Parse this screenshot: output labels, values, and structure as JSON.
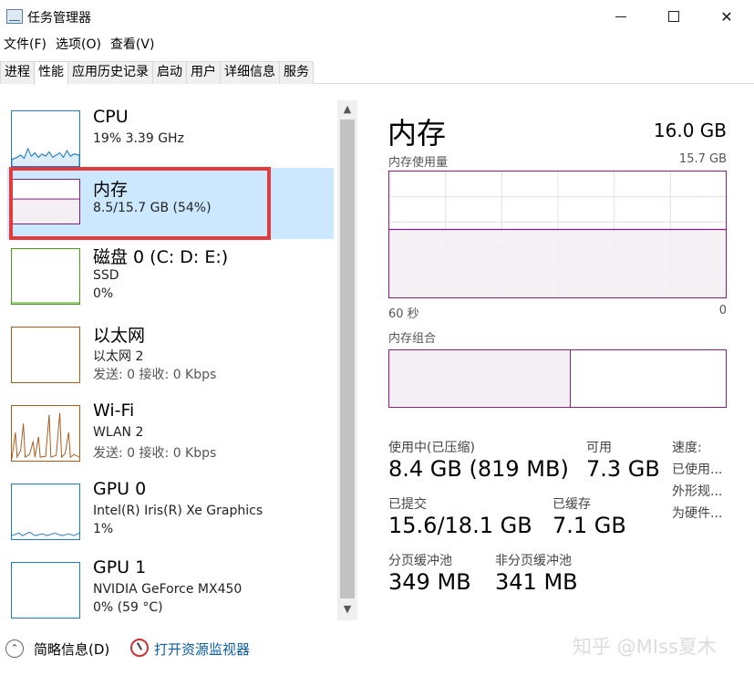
{
  "window": {
    "title": "任务管理器"
  },
  "menu": [
    "文件(F)",
    "选项(O)",
    "查看(V)"
  ],
  "tabs": [
    "进程",
    "性能",
    "应用历史记录",
    "启动",
    "用户",
    "详细信息",
    "服务"
  ],
  "active_tab": "性能",
  "resources": [
    {
      "name": "CPU",
      "line1": "19% 3.39 GHz",
      "line2": "",
      "color": "#1f7ac3"
    },
    {
      "name": "内存",
      "line1": "8.5/15.7 GB (54%)",
      "line2": "",
      "color": "#8b1a8b"
    },
    {
      "name": "磁盘 0 (C: D: E:)",
      "line1": "SSD",
      "line2": "0%",
      "color": "#4b9b1b"
    },
    {
      "name": "以太网",
      "line1": "以太网 2",
      "line2": "发送: 0 接收: 0 Kbps",
      "color": "#a85a1c"
    },
    {
      "name": "Wi-Fi",
      "line1": "WLAN 2",
      "line2": "发送: 0 接收: 0 Kbps",
      "color": "#a85a1c"
    },
    {
      "name": "GPU 0",
      "line1": "Intel(R) Iris(R) Xe Graphics",
      "line2": "1%",
      "color": "#1f7ac3"
    },
    {
      "name": "GPU 1",
      "line1": "NVIDIA GeForce MX450",
      "line2": "0% (59 °C)",
      "color": "#1f7ac3"
    }
  ],
  "memory": {
    "title": "内存",
    "total": "16.0 GB",
    "usage_graph_label": "内存使用量",
    "usage_graph_max": "15.7 GB",
    "usage_fraction": 0.54,
    "time_left": "60 秒",
    "time_right": "0",
    "composition_label": "内存组合",
    "composition_in_use_fraction": 0.54,
    "stats": {
      "in_use_label": "使用中(已压缩)",
      "in_use_value": "8.4 GB (819 MB)",
      "available_label": "可用",
      "available_value": "7.3 GB",
      "committed_label": "已提交",
      "committed_value": "15.6/18.1 GB",
      "cached_label": "已缓存",
      "cached_value": "7.1 GB",
      "paged_label": "分页缓冲池",
      "paged_value": "349 MB",
      "nonpaged_label": "非分页缓冲池",
      "nonpaged_value": "341 MB",
      "speed_label": "速度:",
      "used_label": "已使用...",
      "form_factor_label": "外形规...",
      "hw_reserved_label": "为硬件..."
    }
  },
  "footer": {
    "brief": "简略信息(D)",
    "monitor_link": "打开资源监视器",
    "watermark": "知乎 @MIss夏木"
  }
}
